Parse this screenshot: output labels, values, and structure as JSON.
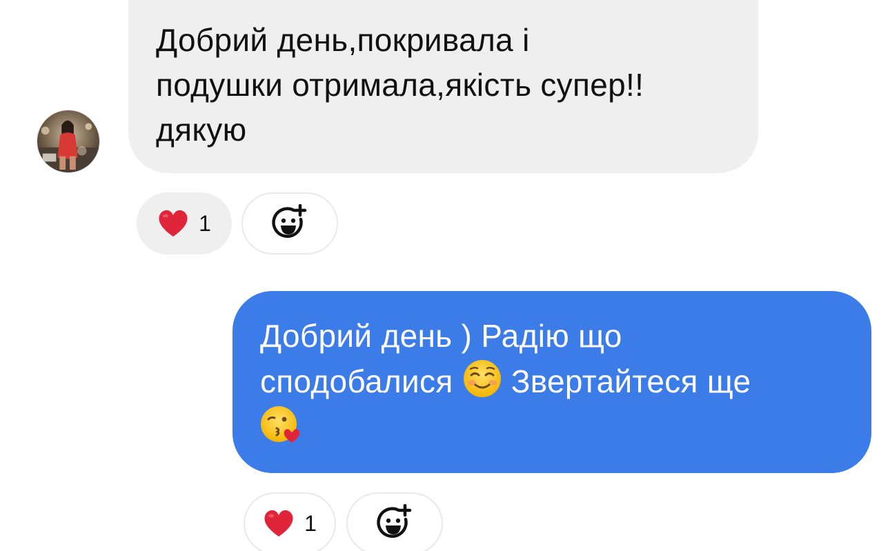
{
  "conversation": {
    "incoming": {
      "text": "Добрий день,покривала і\nподушки отримала,якість супер!!\nдякую",
      "reaction_emoji": "heart",
      "reaction_count": "1"
    },
    "outgoing": {
      "text_line1": "Добрий день ) Радію що",
      "text_line2_a": "сподобалися",
      "text_line2_b": "Звертайтеся ще",
      "emoji_1": "smiling-face-icon",
      "emoji_2": "kissing-face-with-heart-icon",
      "reaction_emoji": "heart",
      "reaction_count": "1"
    }
  },
  "colors": {
    "incoming_bubble": "#efefef",
    "outgoing_bubble": "#3b7ce9",
    "heart": "#e0243a"
  }
}
